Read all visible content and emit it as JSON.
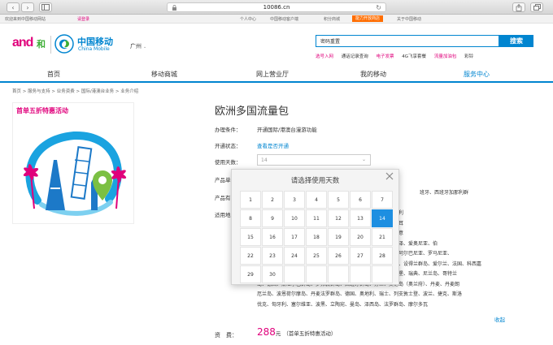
{
  "browser": {
    "url": "10086.cn"
  },
  "topbar": {
    "welcome": "欢迎来到中国移动网站",
    "login": "请登录",
    "links": [
      "个人中心",
      "中国移动客户端",
      "积分商城",
      "能力开放商店",
      "关于中国移动"
    ]
  },
  "header": {
    "brand_and": "and",
    "brand_he": "和",
    "brand_cn": "中国移动",
    "brand_en": "China Mobile",
    "city": "广州",
    "search_value": "密码重置",
    "search_button": "搜索",
    "hot_links": [
      "选号入网",
      "通话记录查询",
      "电子发票",
      "4G飞享套餐",
      "流量加油包",
      "彩铃"
    ]
  },
  "nav": {
    "items": [
      "首页",
      "移动商城",
      "网上营业厅",
      "我的移动",
      "服务中心"
    ],
    "active_index": 4
  },
  "breadcrumb": "首页 > 服务与支持 > 业务资费 > 国际/港澳台业务 > 业务介绍",
  "promo": {
    "title": "首单五折特惠活动"
  },
  "product": {
    "title": "欧洲多国流量包",
    "condition_label": "办理条件：",
    "condition_value": "开通国际/港澳台漫游功能",
    "status_label": "开通状态：",
    "status_link": "查看是否开通",
    "days_label": "使用天数：",
    "days_value": "14",
    "label_4": "产品单",
    "label_5": "产品有",
    "scope_label": "适用地",
    "scope_lines": [
      "班牙、西班牙加那利群",
      "法国、意大利、德国、西班牙、葡萄牙、西班牙加那利群",
      "岛、西班牙休达、西班牙梅利利亚、西班牙梅诺卡岛、西班牙美利利",
      "亚、西班牙马略卡岛、西班牙伊维萨岛、法罗群岛、圣马力诺、马耳",
      "他、直布罗陀、梵蒂冈、摩纳哥、卢森堡、列支敦士登、意大利、意",
      "大利撒丁岛、挪威、冰岛、瑞典、芬兰、丹麦、克里特岛、基克拉泽、爱奥尼亚、伯",
      "罗奔尼撒、希腊、塞浦路斯、马恩岛、根西岛、泽西岛、马耳他、阿尔巴尼亚、罗马尼亚、",
      "保加利亚、斯洛伐克、斯洛文尼亚、爱沙尼亚、拉脱维亚、立陶宛、设得兰群岛、爱尔兰、法国、科西嘉",
      "岛、摩纳哥、安道尔、匈牙利、捷克、波兰、比利时、荷兰、卢森堡、瑞典、尼兰岛、哥特兰",
      "岛、德国、斯堪尔巴群岛、罗弗敦群岛、西班牙群岛、芬兰、艾伦岛（奥兰府）、丹麦、丹麦朗",
      "厄兰岛、波恩荷尔摩岛、丹麦法罗群岛、德国、奥地利、瑞士、列支敦士登、波兰、捷克、斯洛",
      "伐克、匈牙利、塞尔维亚、波黑、立陶宛、曼岛、泽西岛、法罗群岛、摩尔多瓦"
    ],
    "collapse": "收起",
    "price_label": "资　费：",
    "price": "288",
    "price_unit": "元",
    "price_note": "（首单五折特惠活动）"
  },
  "modal": {
    "title": "请选择使用天数",
    "days": [
      "1",
      "2",
      "3",
      "4",
      "5",
      "6",
      "7",
      "8",
      "9",
      "10",
      "11",
      "12",
      "13",
      "14",
      "15",
      "16",
      "17",
      "18",
      "19",
      "20",
      "21",
      "22",
      "23",
      "24",
      "25",
      "26",
      "27",
      "28",
      "29",
      "30"
    ],
    "selected": "14"
  },
  "colors": {
    "brand_blue": "#0085d0",
    "brand_pink": "#e0007b",
    "selected_cell": "#1e8fe1"
  }
}
